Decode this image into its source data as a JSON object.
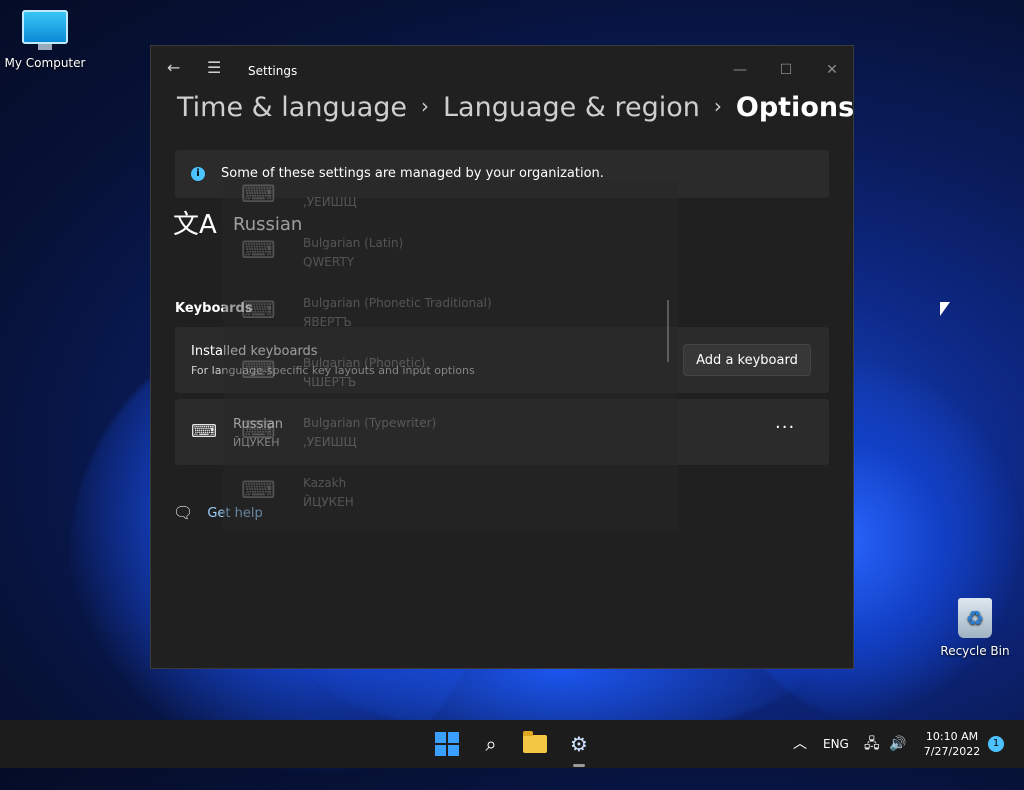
{
  "desktop": {
    "icons": [
      {
        "label": "My Computer"
      },
      {
        "label": "Recycle Bin"
      }
    ]
  },
  "window": {
    "app_title": "Settings",
    "controls": {
      "minimize": "—",
      "maximize": "☐",
      "close": "✕"
    },
    "breadcrumb": [
      "Time & language",
      "Language & region",
      "Options"
    ],
    "info_banner": "Some of these settings are managed by your organization.",
    "language": {
      "name": "Russian"
    },
    "keyboards": {
      "section_title": "Keyboards",
      "installed": {
        "title": "Installed keyboards",
        "subtitle": "For language-specific key layouts and input options",
        "add_button": "Add a keyboard"
      },
      "items": [
        {
          "name": "Russian",
          "layout": "ЙЦУКЕН",
          "more": "···"
        }
      ]
    },
    "get_help": "Get help"
  },
  "flyout": {
    "items": [
      {
        "name": "",
        "layout": ",УЕИШЩ"
      },
      {
        "name": "Bulgarian (Latin)",
        "layout": "QWERTY"
      },
      {
        "name": "Bulgarian (Phonetic Traditional)",
        "layout": "ЯВЕРТЪ"
      },
      {
        "name": "Bulgarian (Phonetic)",
        "layout": "ЧШЕРТЪ"
      },
      {
        "name": "Bulgarian (Typewriter)",
        "layout": ",УЕИШЩ"
      },
      {
        "name": "Kazakh",
        "layout": "ЙЦУКЕН"
      }
    ]
  },
  "taskbar": {
    "tray": {
      "language": "ENG",
      "time": "10:10 AM",
      "date": "7/27/2022",
      "notifications": "1"
    }
  },
  "colors": {
    "accent": "#4cc2ff",
    "window_bg": "#202020",
    "card_bg": "#2b2b2b",
    "taskbar_bg": "#1c1c1c"
  }
}
